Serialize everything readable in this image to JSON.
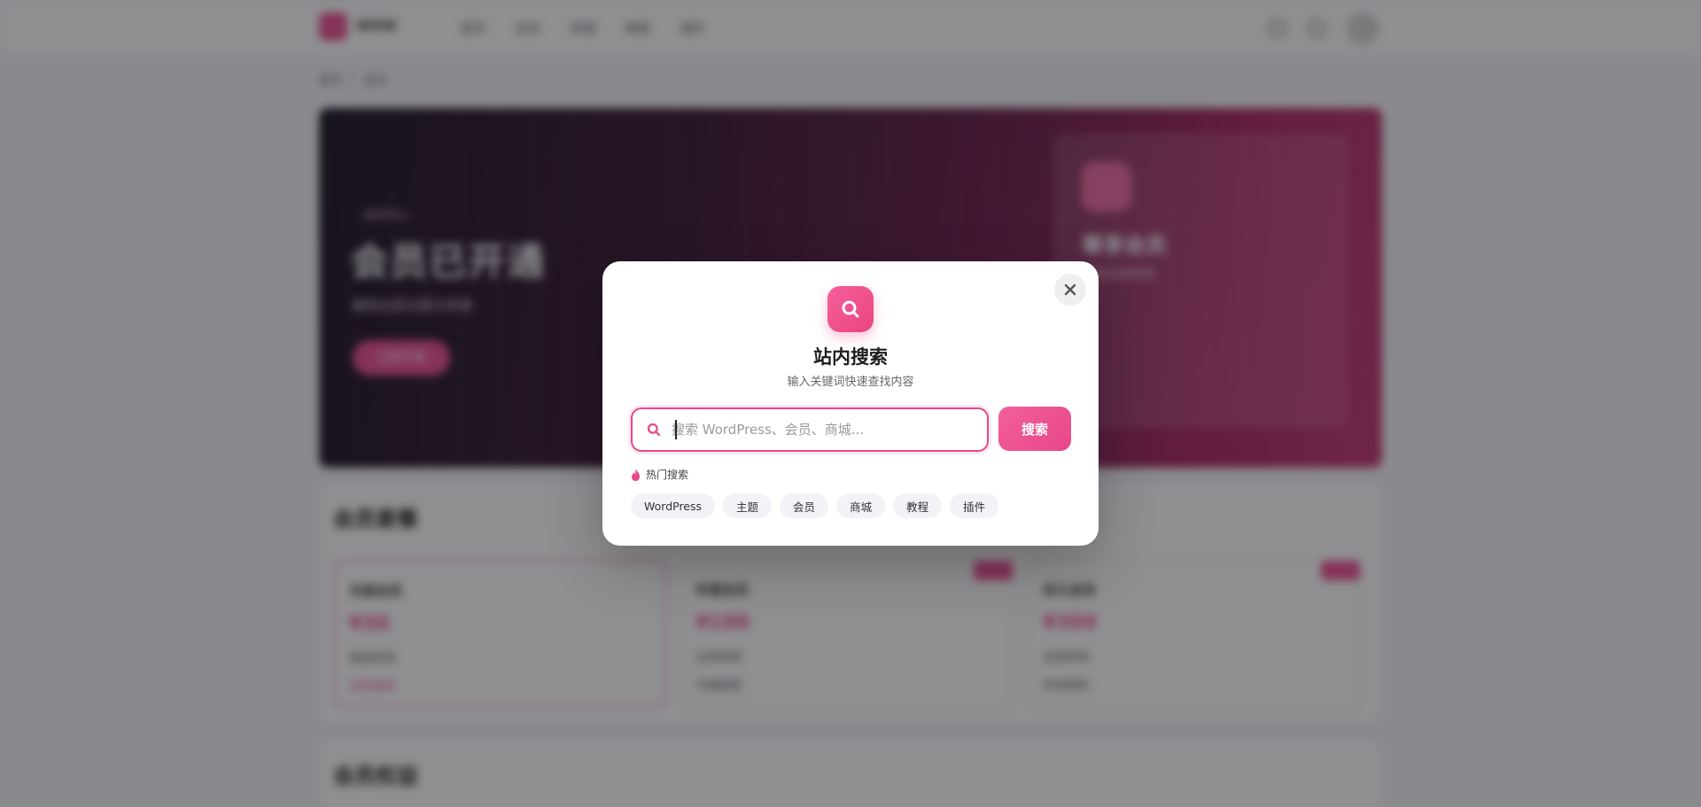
{
  "background": {
    "nav": {
      "logo_text": "WHW",
      "links": [
        "首页",
        "会员",
        "商城",
        "教程",
        "插件"
      ]
    },
    "breadcrumb": [
      "首页",
      "会员"
    ],
    "hero": {
      "tag": "会员中心",
      "title": "会员已开通",
      "subtitle": "解锁全部主题与资源",
      "button": "立即升级",
      "card_title": "尊享会员",
      "card_subtitle": "享受全部特权"
    },
    "section_title": "会员套餐",
    "plans": [
      {
        "name": "月度会员",
        "price": "¥30",
        "line1": "基础权限",
        "line2": "当前套餐"
      },
      {
        "name": "年度会员",
        "price": "¥199",
        "line1": "全部权限",
        "line2": "专属客服"
      },
      {
        "name": "永久会员",
        "price": "¥399",
        "line1": "全部权限",
        "line2": "终身更新"
      }
    ],
    "section2_title": "会员权益"
  },
  "modal": {
    "title": "站内搜索",
    "subtitle": "输入关键词快速查找内容",
    "search": {
      "placeholder": "搜索 WordPress、会员、商城...",
      "value": ""
    },
    "search_button": "搜索",
    "hot_label": "热门搜索",
    "hot_tags": [
      "WordPress",
      "主题",
      "会员",
      "商城",
      "教程",
      "插件"
    ],
    "close_icon": "close-icon",
    "accent": "#e8478a"
  }
}
